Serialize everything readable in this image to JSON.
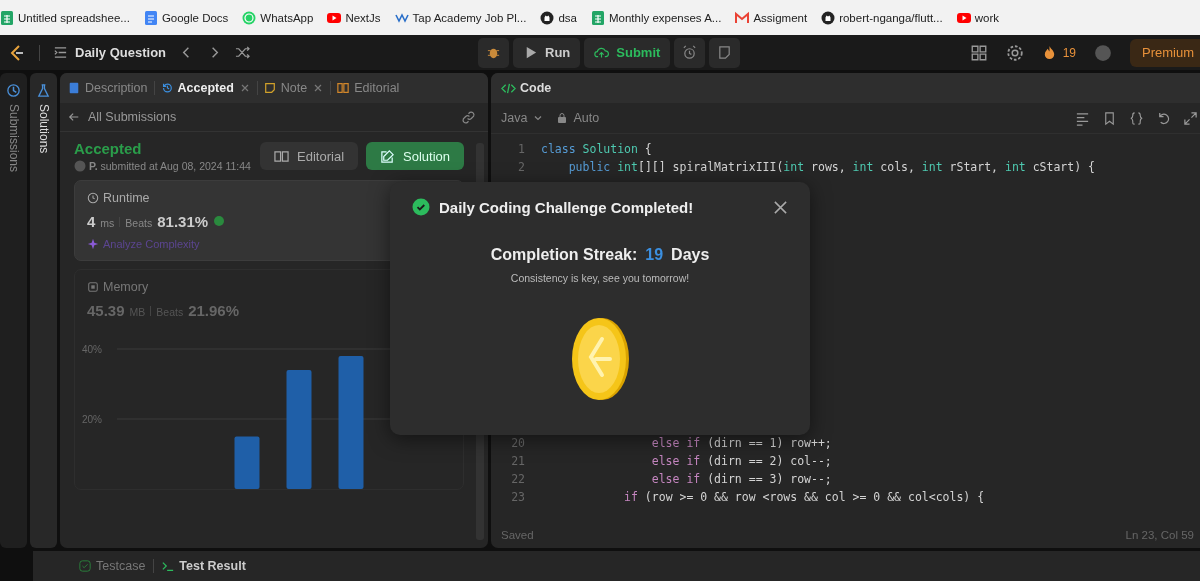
{
  "bookmarks": [
    {
      "label": "Untitled spreadshee...",
      "kind": "sheet"
    },
    {
      "label": "Google Docs",
      "kind": "doc"
    },
    {
      "label": "WhatsApp",
      "kind": "chat"
    },
    {
      "label": "NextJs",
      "kind": "video"
    },
    {
      "label": "Tap Academy Job Pl...",
      "kind": "web"
    },
    {
      "label": "dsa",
      "kind": "github"
    },
    {
      "label": "Monthly expenses A...",
      "kind": "sheet"
    },
    {
      "label": "Assigment",
      "kind": "mail"
    },
    {
      "label": "robert-nganga/flutt...",
      "kind": "github"
    },
    {
      "label": "work",
      "kind": "video"
    }
  ],
  "toolbar": {
    "title": "Daily Question",
    "run": "Run",
    "submit": "Submit",
    "streak": "19",
    "premium": "Premium"
  },
  "side_tabs": [
    {
      "label": "Submissions",
      "selected": false
    },
    {
      "label": "Solutions",
      "selected": true
    }
  ],
  "tabs": [
    {
      "label": "Description",
      "kind": "doc",
      "selected": false,
      "closable": false
    },
    {
      "label": "Accepted",
      "kind": "history",
      "selected": true,
      "closable": true
    },
    {
      "label": "Note",
      "kind": "note",
      "selected": false,
      "closable": true
    },
    {
      "label": "Editorial",
      "kind": "book",
      "selected": false,
      "closable": false
    }
  ],
  "back_link": "All Submissions",
  "submission": {
    "status": "Accepted",
    "byline": "**P.** submitted at Aug 08, 2024 11:44",
    "editorial_button": "Editorial",
    "solution_button": "Solution"
  },
  "runtime": {
    "title": "Runtime",
    "value": "4",
    "unit": "ms",
    "beats_label": "Beats",
    "beats": "81.31%",
    "analyze": "Analyze Complexity",
    "selected": true
  },
  "memory": {
    "title": "Memory",
    "value": "45.39",
    "unit": "MB",
    "beats_label": "Beats",
    "beats": "21.96%",
    "selected": false,
    "chart_data": {
      "type": "bar",
      "ylim": [
        0,
        40
      ],
      "yticks": [
        {
          "value": 20,
          "label": "20%"
        },
        {
          "value": 40,
          "label": "40%"
        }
      ],
      "values": [
        null,
        null,
        15,
        34,
        38,
        null
      ]
    }
  },
  "code": {
    "title": "Code",
    "language": "Java",
    "mode": "Auto",
    "lines": [
      {
        "number": "1",
        "segments": [
          {
            "text": "class ",
            "kind": "keyword"
          },
          {
            "text": "Solution",
            "kind": "type"
          },
          {
            "text": " {",
            "kind": "plain"
          }
        ]
      },
      {
        "number": "2",
        "segments": [
          {
            "text": "    public ",
            "kind": "keyword"
          },
          {
            "text": "int",
            "kind": "type"
          },
          {
            "text": "[][] spiralMatrixIII(",
            "kind": "plain"
          },
          {
            "text": "int",
            "kind": "type"
          },
          {
            "text": " rows, ",
            "kind": "plain"
          },
          {
            "text": "int",
            "kind": "type"
          },
          {
            "text": " cols, ",
            "kind": "plain"
          },
          {
            "text": "int",
            "kind": "type"
          },
          {
            "text": " rStart, ",
            "kind": "plain"
          },
          {
            "text": "int",
            "kind": "type"
          },
          {
            "text": " cStart) {",
            "kind": "plain"
          }
        ]
      },
      {
        "number": "20",
        "segments": [
          {
            "text": "                else if ",
            "kind": "control"
          },
          {
            "text": "(dirn == 1) row++;",
            "kind": "plain"
          }
        ]
      },
      {
        "number": "21",
        "segments": [
          {
            "text": "                else if ",
            "kind": "control"
          },
          {
            "text": "(dirn == 2) col--;",
            "kind": "plain"
          }
        ]
      },
      {
        "number": "22",
        "segments": [
          {
            "text": "                else if ",
            "kind": "control"
          },
          {
            "text": "(dirn == 3) row--;",
            "kind": "plain"
          }
        ]
      },
      {
        "number": "23",
        "segments": [
          {
            "text": "            if ",
            "kind": "control"
          },
          {
            "text": "(row >= 0 && row <rows && col >= 0 && col<cols) {",
            "kind": "plain"
          }
        ]
      }
    ],
    "status": "Saved",
    "cursor": "Ln 23, Col 59"
  },
  "bottom_tabs": [
    {
      "label": "Testcase",
      "kind": "check",
      "selected": false
    },
    {
      "label": "Test Result",
      "kind": "terminal",
      "selected": true
    }
  ],
  "dialog": {
    "title": "Daily Coding Challenge Completed!",
    "streak_label": "Completion Streak:",
    "streak_value": "19",
    "streak_unit": "Days",
    "message": "Consistency is key, see you tomorrow!"
  }
}
